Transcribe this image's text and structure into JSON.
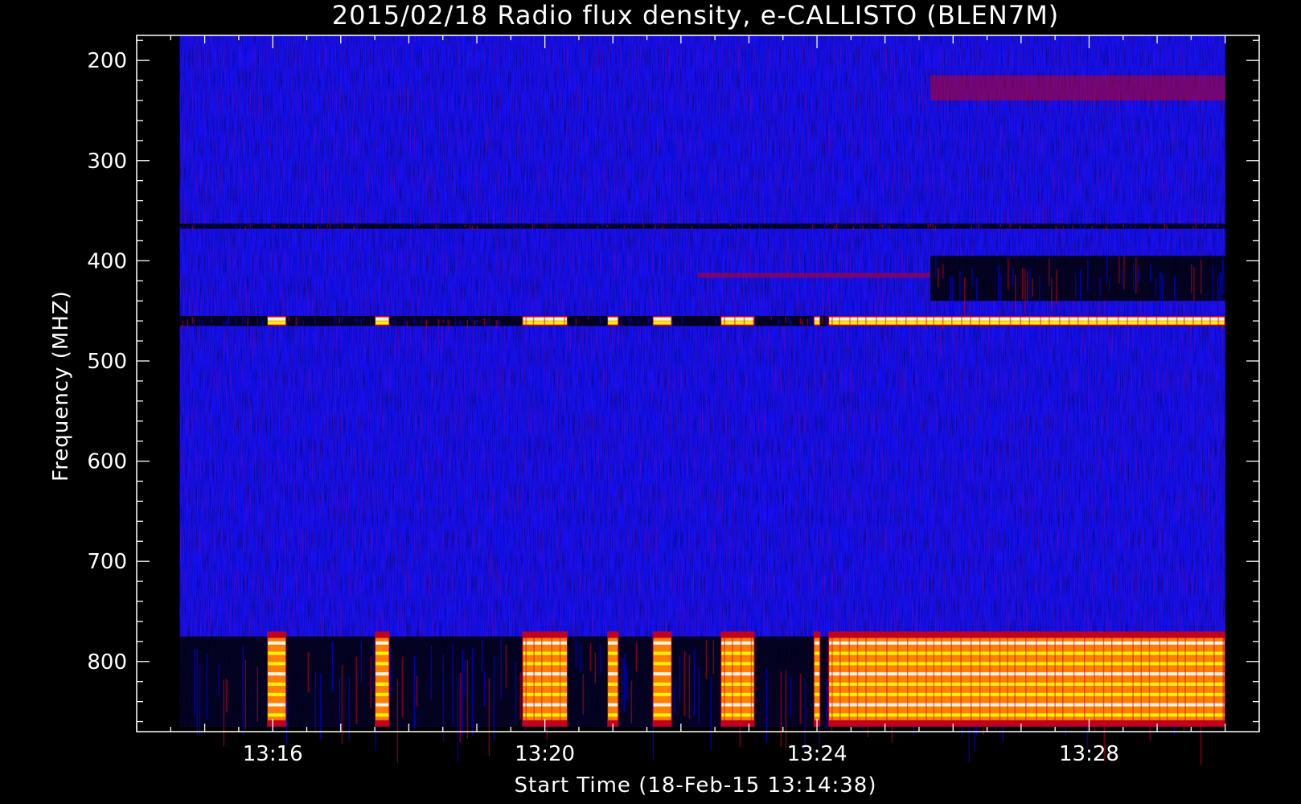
{
  "chart_data": {
    "type": "heatmap",
    "title": "2015/02/18  Radio flux density, e-CALLISTO (BLEN7M)",
    "xlabel": "Start Time (18-Feb-15 13:14:38)",
    "ylabel": "Frequency (MHZ)",
    "x_unit": "time",
    "x_start": "13:14:38",
    "x_end": "13:30:00",
    "xlim": [
      "13:14:00",
      "13:30:30"
    ],
    "x_ticks": [
      {
        "value": "13:16",
        "label": "13:16"
      },
      {
        "value": "13:20",
        "label": "13:20"
      },
      {
        "value": "13:24",
        "label": "13:24"
      },
      {
        "value": "13:28",
        "label": "13:28"
      }
    ],
    "y_axis_inverted": true,
    "ylim": [
      175,
      870
    ],
    "y_data_range": [
      175,
      865
    ],
    "y_ticks": [
      200,
      300,
      400,
      500,
      600,
      700,
      800
    ],
    "colormap": [
      "#000000",
      "#0000ff",
      "#c00020",
      "#ff8000",
      "#ffff00",
      "#ffffff"
    ],
    "background_level_color": "#1010f0",
    "features": [
      {
        "type": "band",
        "freq_range": [
          455,
          465
        ],
        "time_range": [
          "13:14:38",
          "13:30:00"
        ],
        "level": "dark"
      },
      {
        "type": "band",
        "freq_range": [
          775,
          865
        ],
        "time_range": [
          "13:14:38",
          "13:30:00"
        ],
        "level": "dark"
      },
      {
        "type": "band",
        "freq_range": [
          363,
          368
        ],
        "time_range": [
          "13:14:38",
          "13:30:00"
        ],
        "level": "dark"
      },
      {
        "type": "band",
        "freq_range": [
          412,
          417
        ],
        "time_range": [
          "13:22:15",
          "13:25:40"
        ],
        "level": "red"
      },
      {
        "type": "band",
        "freq_range": [
          395,
          440
        ],
        "time_range": [
          "13:25:40",
          "13:30:00"
        ],
        "level": "dark"
      },
      {
        "type": "band",
        "freq_range": [
          215,
          240
        ],
        "time_range": [
          "13:25:40",
          "13:30:00"
        ],
        "level": "red"
      },
      {
        "type": "burst",
        "time_range": [
          "13:15:55",
          "13:16:12"
        ],
        "freq_bands": [
          [
            455,
            465
          ],
          [
            770,
            865
          ]
        ],
        "level": "bright"
      },
      {
        "type": "burst",
        "time_range": [
          "13:17:30",
          "13:17:43"
        ],
        "freq_bands": [
          [
            455,
            465
          ],
          [
            770,
            865
          ]
        ],
        "level": "bright"
      },
      {
        "type": "burst",
        "time_range": [
          "13:19:40",
          "13:20:20"
        ],
        "freq_bands": [
          [
            455,
            465
          ],
          [
            770,
            865
          ]
        ],
        "level": "bright"
      },
      {
        "type": "burst",
        "time_range": [
          "13:20:55",
          "13:21:05"
        ],
        "freq_bands": [
          [
            455,
            465
          ],
          [
            770,
            865
          ]
        ],
        "level": "bright"
      },
      {
        "type": "burst",
        "time_range": [
          "13:21:35",
          "13:21:52"
        ],
        "freq_bands": [
          [
            455,
            465
          ],
          [
            770,
            865
          ]
        ],
        "level": "bright"
      },
      {
        "type": "burst",
        "time_range": [
          "13:22:35",
          "13:23:05"
        ],
        "freq_bands": [
          [
            455,
            465
          ],
          [
            770,
            865
          ]
        ],
        "level": "bright"
      },
      {
        "type": "burst",
        "time_range": [
          "13:23:57",
          "13:24:03"
        ],
        "freq_bands": [
          [
            455,
            465
          ],
          [
            770,
            865
          ]
        ],
        "level": "bright"
      },
      {
        "type": "burst",
        "time_range": [
          "13:24:10",
          "13:30:00"
        ],
        "freq_bands": [
          [
            455,
            465
          ],
          [
            770,
            865
          ]
        ],
        "level": "bright"
      }
    ]
  }
}
